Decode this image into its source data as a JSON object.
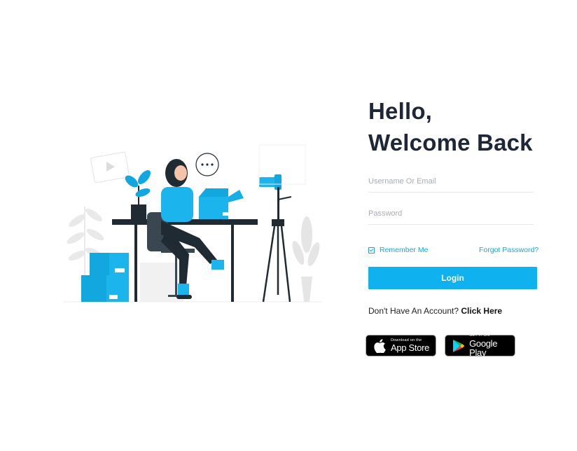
{
  "login": {
    "heading_line1": "Hello,",
    "heading_line2": "Welcome Back",
    "username_placeholder": "Username Or Email",
    "password_placeholder": "Password",
    "remember_label": "Remember Me",
    "forgot_label": "Forgot Password?",
    "login_label": "Login",
    "signup_prompt": "Don't Have An Account?",
    "signup_link": "Click Here"
  },
  "badges": {
    "appstore_small": "Download on the",
    "appstore_big": "App Store",
    "googleplay_small": "GET IT ON",
    "googleplay_big": "Google Play"
  },
  "colors": {
    "accent": "#0fb2ef",
    "heading": "#1d2738",
    "link": "#1aa5e0"
  },
  "icons": [
    "check-icon",
    "apple-icon",
    "google-play-icon"
  ]
}
